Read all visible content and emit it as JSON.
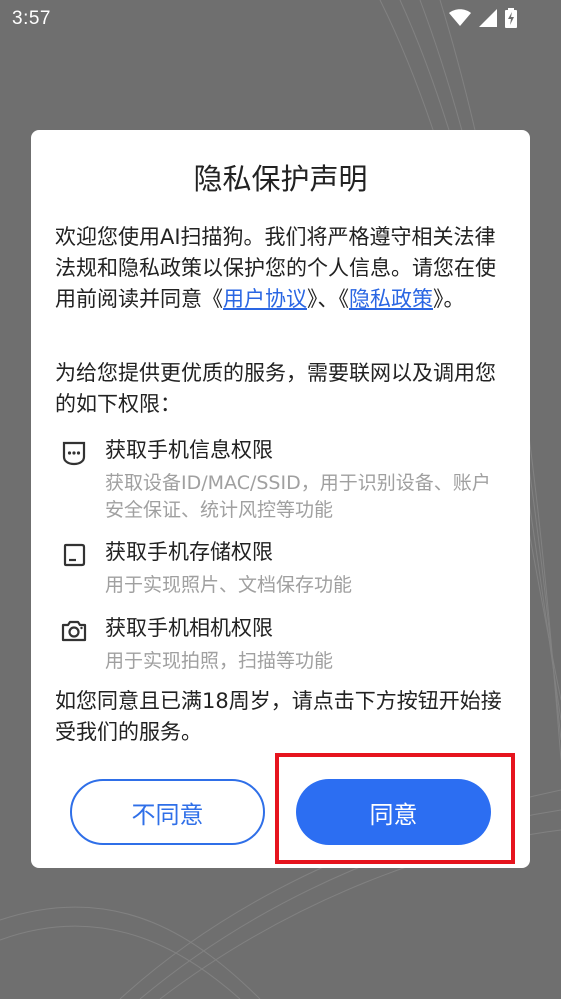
{
  "status_bar": {
    "time": "3:57"
  },
  "dialog": {
    "title": "隐私保护声明",
    "intro_prefix": "欢迎您使用AI扫描狗。我们将严格遵守相关法律法规和隐私政策以保护您的个人信息。请您在使用前阅读并同意《",
    "user_agreement_link": "用户协议",
    "intro_mid": "》、《",
    "privacy_policy_link": "隐私政策",
    "intro_suffix": "》。",
    "permission_intro": "为给您提供更优质的服务，需要联网以及调用您的如下权限：",
    "permissions": [
      {
        "icon": "phone-info-icon",
        "title": "获取手机信息权限",
        "desc": "获取设备ID/MAC/SSID，用于识别设备、账户安全保证、统计风控等功能"
      },
      {
        "icon": "storage-icon",
        "title": "获取手机存储权限",
        "desc": "用于实现照片、文档保存功能"
      },
      {
        "icon": "camera-icon",
        "title": "获取手机相机权限",
        "desc": "用于实现拍照，扫描等功能"
      }
    ],
    "consent_text": "如您同意且已满18周岁，请点击下方按钮开始接受我们的服务。",
    "buttons": {
      "disagree": "不同意",
      "agree": "同意"
    }
  },
  "colors": {
    "accent": "#2c6ef2",
    "link": "#2a66e3",
    "highlight": "#e6141e",
    "overlay_bg": "#6e6e6e"
  }
}
